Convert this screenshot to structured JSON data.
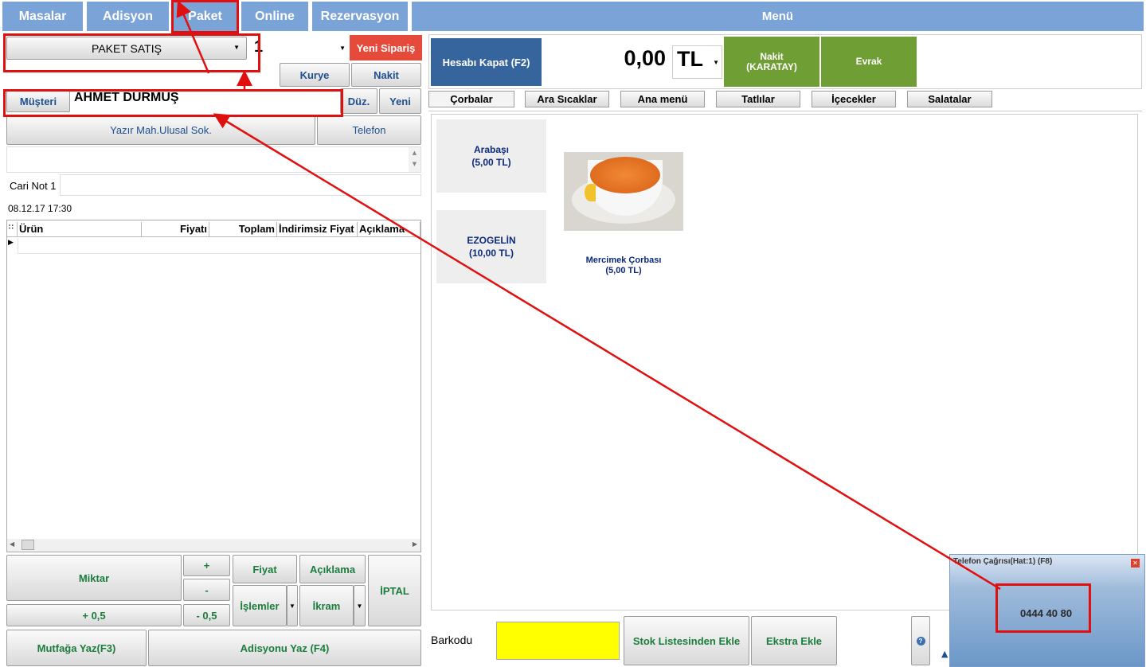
{
  "topbar": {
    "tabs": [
      "Masalar",
      "Adisyon",
      "Paket",
      "Online",
      "Rezervasyon"
    ],
    "menu_label": "Menü"
  },
  "order": {
    "sale_type": "PAKET SATIŞ",
    "order_number": "1",
    "new_order": "Yeni Sipariş",
    "courier": "Kurye",
    "cash": "Nakit"
  },
  "customer": {
    "button": "Müşteri",
    "name": "AHMET DURMUŞ",
    "edit": "Düz.",
    "new": "Yeni",
    "address": "Yazır Mah.Ulusal Sok.",
    "phone": "Telefon",
    "note_label": "Cari Not 1",
    "note_value": "",
    "datetime": "08.12.17 17:30"
  },
  "grid": {
    "columns": [
      "Ürün",
      "Fiyatı",
      "Toplam",
      "İndirimsiz Fiyat",
      "Açıklama"
    ]
  },
  "controls": {
    "quantity": "Miktar",
    "plus": "+",
    "minus": "-",
    "plus_half": "+ 0,5",
    "minus_half": "- 0,5",
    "price": "Fiyat",
    "description": "Açıklama",
    "operations": "İşlemler",
    "treat": "İkram",
    "cancel": "İPTAL",
    "kitchen": "Mutfağa Yaz(F3)",
    "print_bill": "Adisyonu Yaz (F4)"
  },
  "payment": {
    "close_bill": "Hesabı Kapat (F2)",
    "amount": "0,00",
    "currency": "TL",
    "cash_karatay": "Nakit\n(KARATAY)",
    "document": "Evrak"
  },
  "categories": [
    "Çorbalar",
    "Ara Sıcaklar",
    "Ana menü",
    "Tatlılar",
    "İçecekler",
    "Salatalar"
  ],
  "products": [
    {
      "name": "Arabaşı",
      "price": "(5,00 TL)"
    },
    {
      "name": "EZOGELİN",
      "price": "(10,00 TL)"
    },
    {
      "name": "Mercimek Çorbası",
      "price": "(5,00 TL)"
    }
  ],
  "barcode": {
    "label": "Barkodu",
    "value": "",
    "stock_list": "Stok Listesinden Ekle",
    "extra": "Ekstra Ekle"
  },
  "call_popup": {
    "title": "Telefon Çağrısı(Hat:1) (F8)",
    "number": "0444 40 80"
  },
  "colors": {
    "tab_blue": "#7aa3d8",
    "close_bill_blue": "#36649c",
    "new_order_red": "#e64a3b",
    "pay_green": "#6f9e34",
    "barcode_yellow": "#ffff00",
    "annotation_red": "#e01010"
  }
}
